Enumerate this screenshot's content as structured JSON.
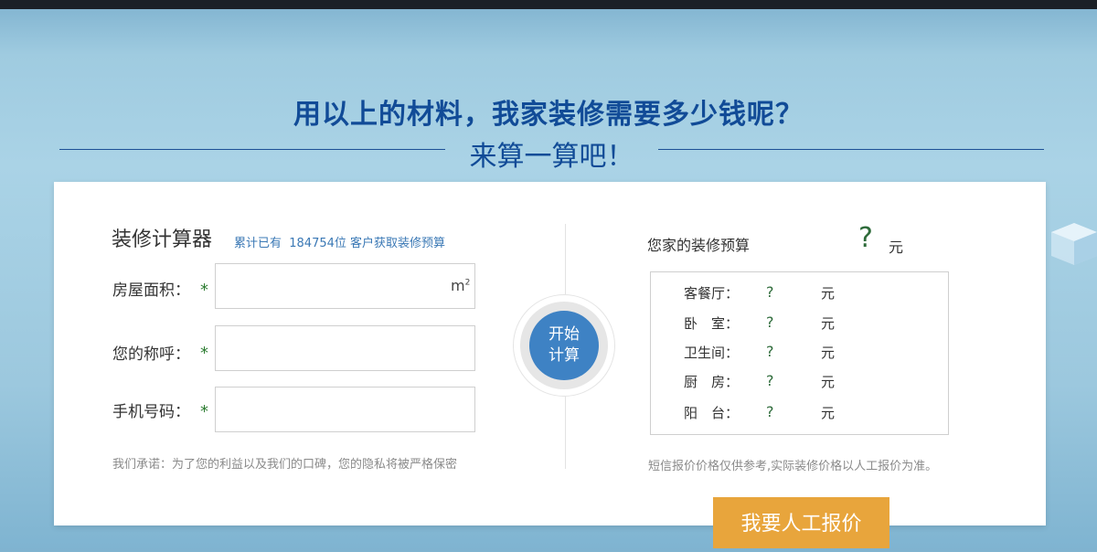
{
  "headline": "用以上的材料，我家装修需要多少钱呢？",
  "subheadline": "来算一算吧！",
  "calculator": {
    "title": "装修计算器",
    "count_text": "累计已有  184754位 客户获取装修预算",
    "fields": [
      {
        "label": "房屋面积：",
        "required": "*",
        "value": "",
        "unit": "m²"
      },
      {
        "label": "您的称呼：",
        "required": "*",
        "value": ""
      },
      {
        "label": "手机号码：",
        "required": "*",
        "value": ""
      }
    ],
    "promise": "我们承诺：为了您的利益以及我们的口碑，您的隐私将被严格保密",
    "button_line1": "开始",
    "button_line2": "计算"
  },
  "budget": {
    "title": "您家的装修预算",
    "total_value": "?",
    "total_unit": "元",
    "rows": [
      {
        "label": "客餐厅：",
        "value": "?",
        "unit": "元"
      },
      {
        "label": "卧　室：",
        "value": "?",
        "unit": "元"
      },
      {
        "label": "卫生间：",
        "value": "?",
        "unit": "元"
      },
      {
        "label": "厨　房：",
        "value": "?",
        "unit": "元"
      },
      {
        "label": "阳　台：",
        "value": "?",
        "unit": "元"
      }
    ],
    "note": "短信报价价格仅供参考,实际装修价格以人工报价为准。"
  },
  "quote_button": "我要人工报价",
  "colors": {
    "title_blue": "#114b97",
    "button_blue": "#3e82c4",
    "button_orange": "#e8a53c",
    "required_green": "#2e7d32"
  }
}
